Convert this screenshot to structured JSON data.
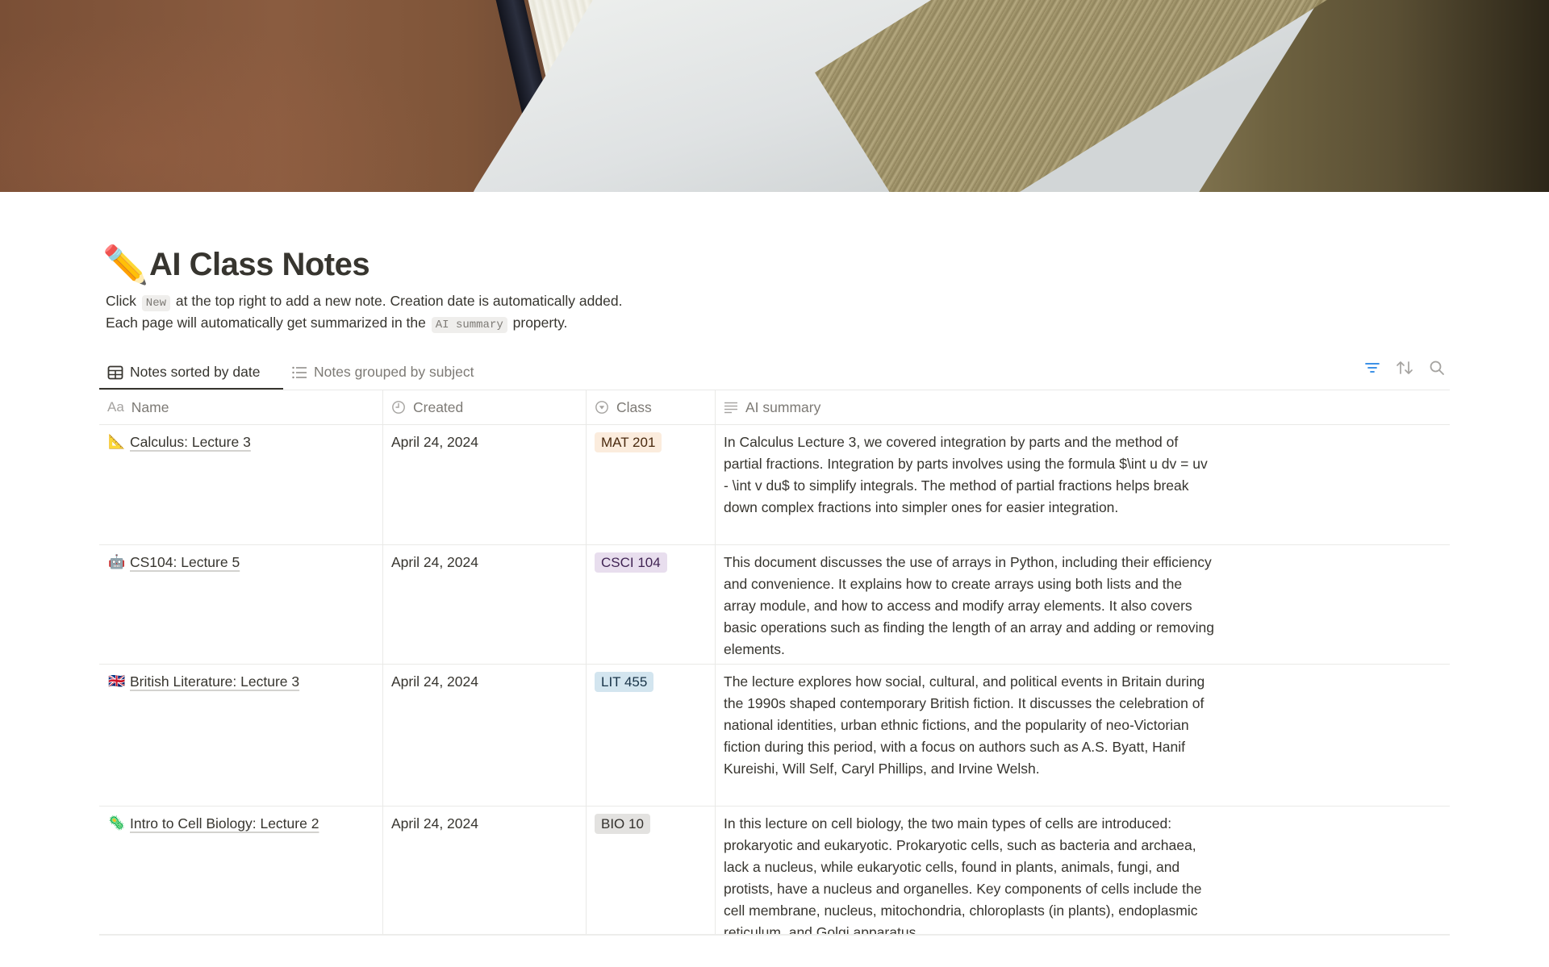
{
  "cover": {
    "description": "open book on wooden desk"
  },
  "page": {
    "icon": "✏️",
    "icon_name": "pencil-icon",
    "title": "AI Class Notes",
    "description": {
      "line1_before": "Click",
      "line1_code": "New",
      "line1_after": "at the top right to add a new note. Creation date is automatically added.",
      "line2_before": "Each page will automatically get summarized in the",
      "line2_code": "AI summary",
      "line2_after": "property."
    }
  },
  "views": {
    "tabs": [
      {
        "label": "Notes sorted by date",
        "icon": "table-icon",
        "active": true
      },
      {
        "label": "Notes grouped by subject",
        "icon": "list-icon",
        "active": false
      }
    ],
    "actions": [
      {
        "name": "filter-icon",
        "color": "#2383e2",
        "active": true
      },
      {
        "name": "sort-icon",
        "color": "#a5a3a0",
        "active": false
      },
      {
        "name": "search-icon",
        "color": "#a5a3a0",
        "active": false
      }
    ]
  },
  "table": {
    "columns": [
      {
        "label": "Name",
        "icon": "text-property-icon",
        "icon_glyph": "Aa"
      },
      {
        "label": "Created",
        "icon": "clock-icon"
      },
      {
        "label": "Class",
        "icon": "select-property-icon"
      },
      {
        "label": "AI summary",
        "icon": "text-lines-icon"
      }
    ],
    "rows": [
      {
        "emoji": "📐",
        "emoji_name": "triangular-ruler-icon",
        "name": "Calculus: Lecture 3",
        "created": "April 24, 2024",
        "class": "MAT 201",
        "class_bg": "#fbecdd",
        "class_color": "#49290e",
        "summary": "In Calculus Lecture 3, we covered integration by parts and the method of partial fractions. Integration by parts involves using the formula $\\int u dv = uv - \\int v du$ to simplify integrals. The method of partial fractions helps break down complex fractions into simpler ones for easier integration."
      },
      {
        "emoji": "🤖",
        "emoji_name": "robot-icon",
        "name": "CS104: Lecture 5",
        "created": "April 24, 2024",
        "class": "CSCI 104",
        "class_bg": "#e8deee",
        "class_color": "#412454",
        "summary": "This document discusses the use of arrays in Python, including their efficiency and convenience. It explains how to create arrays using both lists and the array module, and how to access and modify array elements. It also covers basic operations such as finding the length of an array and adding or removing elements."
      },
      {
        "emoji": "🇬🇧",
        "emoji_name": "uk-flag-icon",
        "name": "British Literature: Lecture 3",
        "created": "April 24, 2024",
        "class": "LIT 455",
        "class_bg": "#d3e5ef",
        "class_color": "#183347",
        "summary": "The lecture explores how social, cultural, and political events in Britain during the 1990s shaped contemporary British fiction. It discusses the celebration of national identities, urban ethnic fictions, and the popularity of neo-Victorian fiction during this period, with a focus on authors such as A.S. Byatt, Hanif Kureishi, Will Self, Caryl Phillips, and Irvine Welsh."
      },
      {
        "emoji": "🦠",
        "emoji_name": "microbe-icon",
        "name": "Intro to Cell Biology: Lecture 2",
        "created": "April 24, 2024",
        "class": "BIO 10",
        "class_bg": "#e3e2e0",
        "class_color": "#32302c",
        "summary": "In this lecture on cell biology, the two main types of cells are introduced: prokaryotic and eukaryotic. Prokaryotic cells, such as bacteria and archaea, lack a nucleus, while eukaryotic cells, found in plants, animals, fungi, and protists, have a nucleus and organelles. Key components of cells include the cell membrane, nucleus, mitochondria, chloroplasts (in plants), endoplasmic reticulum, and Golgi apparatus."
      }
    ]
  }
}
